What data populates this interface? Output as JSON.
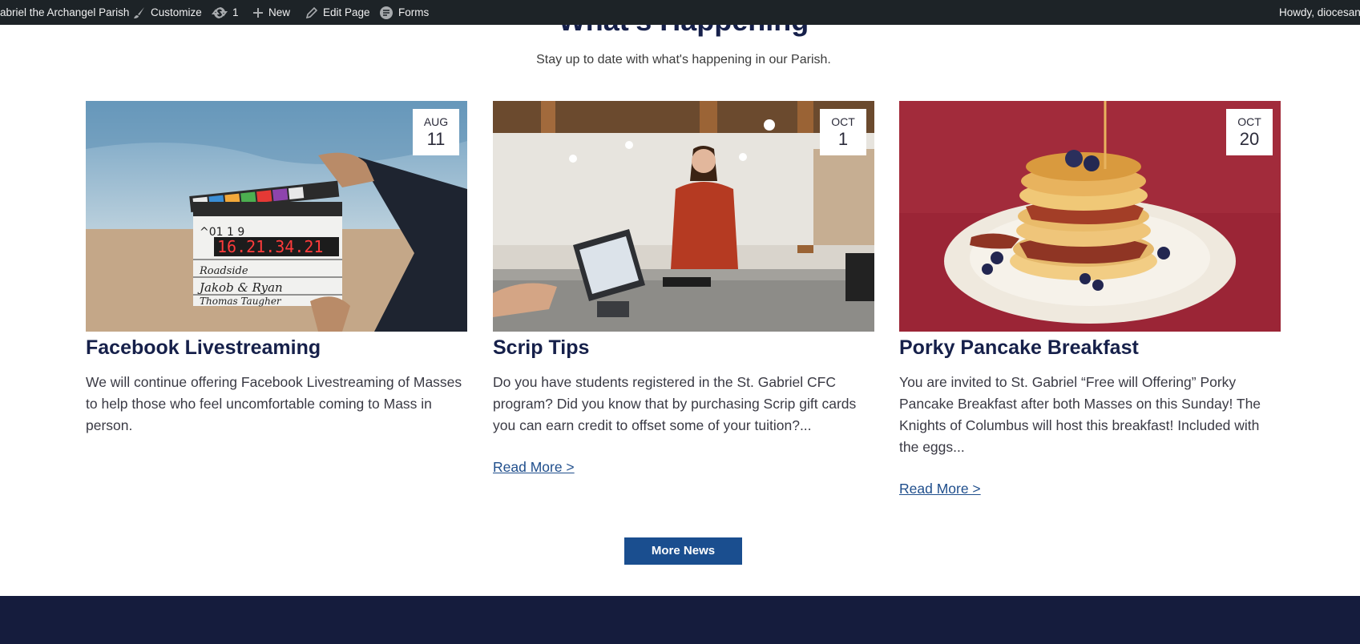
{
  "admin_bar": {
    "site_name": "abriel the Archangel Parish",
    "customize_label": "Customize",
    "updates_count": "1",
    "new_label": "New",
    "edit_page_label": "Edit Page",
    "forms_label": "Forms",
    "howdy_text": "Howdy, diocesan-"
  },
  "section": {
    "title": "What's Happening",
    "subtitle": "Stay up to date with what's happening in our Parish."
  },
  "cards": [
    {
      "month": "AUG",
      "day": "11",
      "title": "Facebook Livestreaming",
      "text": "We will continue offering Facebook Livestreaming of Masses to help those who feel uncomfortable coming to Mass in person.",
      "image": "clapperboard-photo"
    },
    {
      "month": "OCT",
      "day": "1",
      "title": "Scrip Tips",
      "text": "Do you have students registered in the St. Gabriel CFC program? Did you know that by purchasing Scrip gift cards you can earn credit to offset some of your tuition?...",
      "read_more": "Read More >",
      "image": "cafe-checkout-photo"
    },
    {
      "month": "OCT",
      "day": "20",
      "title": "Porky Pancake Breakfast",
      "text": "You are invited to St. Gabriel “Free will Offering” Porky Pancake Breakfast after both Masses on this Sunday! The Knights of Columbus will host this breakfast! Included with the eggs...",
      "read_more": "Read More >",
      "image": "pancake-stack-photo"
    }
  ],
  "more_news_label": "More News",
  "colors": {
    "admin_bar": "#1d2327",
    "heading": "#16204a",
    "link": "#1f4e8c",
    "button": "#1a4e8f",
    "footer": "#151c3d"
  }
}
